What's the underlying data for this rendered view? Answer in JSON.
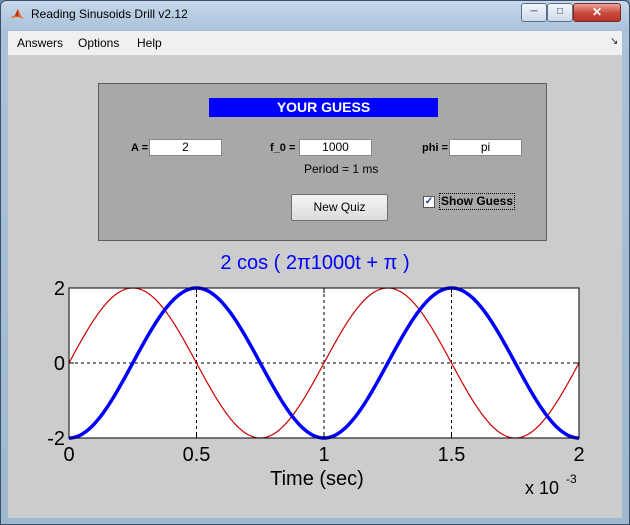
{
  "window": {
    "title": "Reading Sinusoids Drill v2.12"
  },
  "menu": {
    "answers": "Answers",
    "options": "Options",
    "help": "Help"
  },
  "panel": {
    "title": "YOUR GUESS",
    "a_label": "A =",
    "a_value": "2",
    "f0_label": "f_0 =",
    "f0_value": "1000",
    "phi_label": "phi =",
    "phi_value": "pi",
    "period_text": "Period = 1 ms",
    "new_quiz_label": "New Quiz",
    "show_guess_label": "Show Guess",
    "show_guess_checked": true
  },
  "colors": {
    "guess_blue": "#0000ff",
    "quiz_red": "#cc0000",
    "panel_title_bg": "#0000ff"
  },
  "formula": "2 cos ( 2π1000t + π )",
  "chart_data": {
    "type": "line",
    "title": "2 cos ( 2π1000t + π )",
    "xlabel": "Time  (sec)",
    "x_multiplier": "x 10",
    "x_multiplier_exp": "-3",
    "xlim": [
      0,
      0.002
    ],
    "ylim": [
      -2,
      2
    ],
    "xticks": [
      0,
      0.0005,
      0.001,
      0.0015,
      0.002
    ],
    "xtick_labels": [
      "0",
      "0.5",
      "1",
      "1.5",
      "2"
    ],
    "yticks": [
      -2,
      0,
      2
    ],
    "ytick_labels": [
      "-2",
      "0",
      "2"
    ],
    "grid": true,
    "series": [
      {
        "amplitude": 2,
        "frequency": 1000,
        "phase": 3.14159,
        "color": "#0000ff",
        "line": "thick"
      },
      {
        "amplitude": 2,
        "frequency": 1000,
        "phase": -1.5708,
        "color": "#cc0000",
        "line": "thin"
      }
    ]
  }
}
